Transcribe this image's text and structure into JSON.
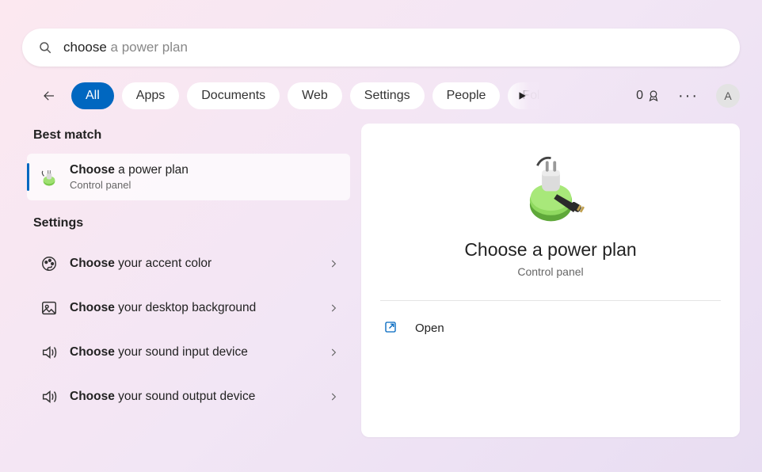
{
  "search": {
    "typed": "choose",
    "completion": " a power plan"
  },
  "tabs": [
    "All",
    "Apps",
    "Documents",
    "Web",
    "Settings",
    "People",
    "Folders"
  ],
  "rewards_count": "0",
  "avatar_letter": "A",
  "sections": {
    "best_match_header": "Best match",
    "settings_header": "Settings"
  },
  "best_match": {
    "title_bold": "Choose",
    "title_rest": " a power plan",
    "subtitle": "Control panel",
    "icon": "power"
  },
  "settings_results": [
    {
      "bold": "Choose",
      "rest": " your accent color",
      "icon": "palette"
    },
    {
      "bold": "Choose",
      "rest": " your desktop background",
      "icon": "image"
    },
    {
      "bold": "Choose",
      "rest": " your sound input device",
      "icon": "sound"
    },
    {
      "bold": "Choose",
      "rest": " your sound output device",
      "icon": "sound"
    }
  ],
  "detail": {
    "title": "Choose a power plan",
    "subtitle": "Control panel",
    "actions": [
      {
        "label": "Open",
        "icon": "open"
      }
    ]
  }
}
